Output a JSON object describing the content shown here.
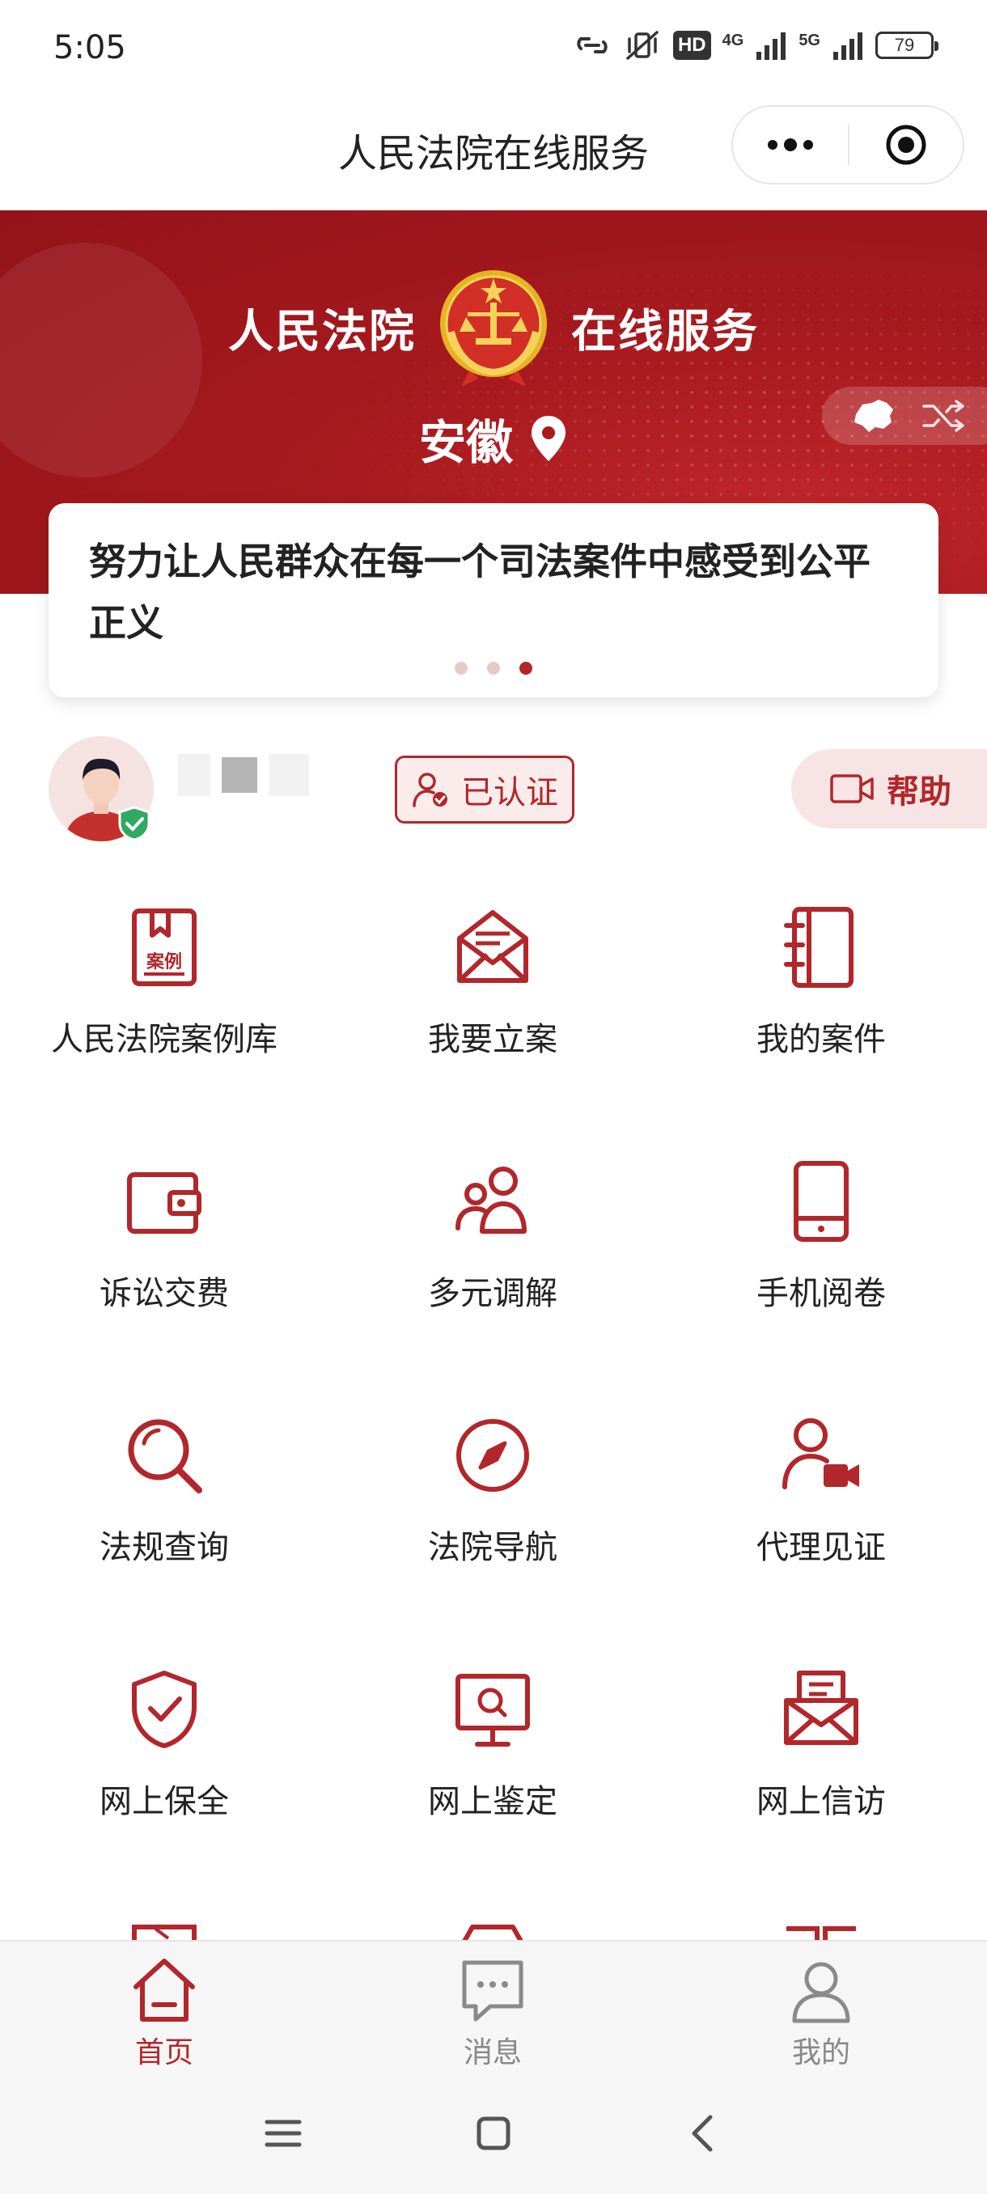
{
  "status_bar": {
    "time": "5:05",
    "hd": "HD",
    "net_4g": "4G",
    "net_5g": "5G",
    "battery": "79"
  },
  "nav": {
    "title": "人民法院在线服务"
  },
  "banner": {
    "left_text": "人民法院",
    "right_text": "在线服务",
    "location": "安徽",
    "slogan": "努力让人民群众在每一个司法案件中感受到公平正义",
    "carousel_active_index": 2,
    "carousel_count": 3
  },
  "user": {
    "verified_label": "已认证",
    "help_label": "帮助"
  },
  "services": [
    {
      "label": "人民法院案例库",
      "icon": "case-library-icon"
    },
    {
      "label": "我要立案",
      "icon": "envelope-file-icon"
    },
    {
      "label": "我的案件",
      "icon": "case-notebook-icon"
    },
    {
      "label": "诉讼交费",
      "icon": "wallet-icon"
    },
    {
      "label": "多元调解",
      "icon": "people-icon"
    },
    {
      "label": "手机阅卷",
      "icon": "phone-icon"
    },
    {
      "label": "法规查询",
      "icon": "search-icon"
    },
    {
      "label": "法院导航",
      "icon": "compass-icon"
    },
    {
      "label": "代理见证",
      "icon": "person-video-icon"
    },
    {
      "label": "网上保全",
      "icon": "shield-check-icon"
    },
    {
      "label": "网上鉴定",
      "icon": "monitor-search-icon"
    },
    {
      "label": "网上信访",
      "icon": "mail-letter-icon"
    }
  ],
  "tabs": [
    {
      "label": "首页",
      "icon": "home-icon",
      "active": true
    },
    {
      "label": "消息",
      "icon": "message-icon",
      "active": false
    },
    {
      "label": "我的",
      "icon": "user-icon",
      "active": false
    }
  ],
  "colors": {
    "brand_red": "#b1272b",
    "banner_red": "#a81a1f",
    "tab_inactive": "#888888"
  }
}
